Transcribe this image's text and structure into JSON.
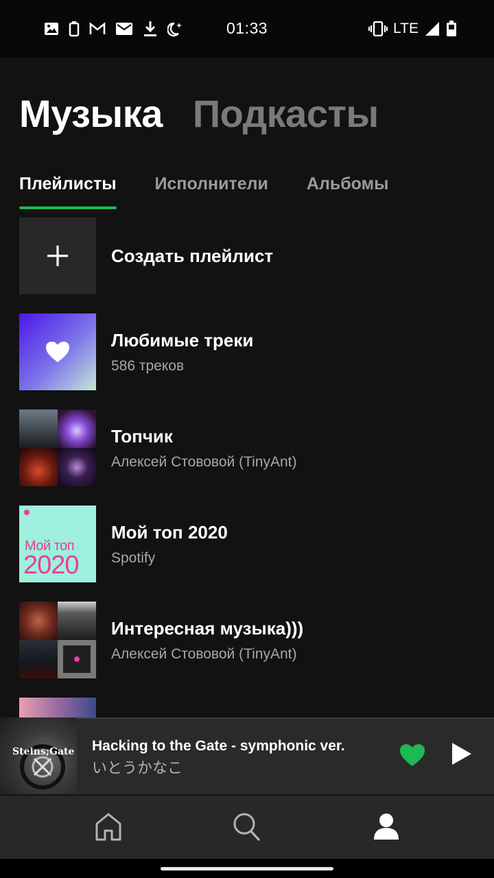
{
  "status_bar": {
    "time": "01:33",
    "network": "LTE",
    "left_icons": [
      "image-icon",
      "battery-saver-icon",
      "gmail-icon",
      "mail-icon",
      "download-icon",
      "night-mode-icon"
    ],
    "right_icons": [
      "vibrate-icon",
      "signal-icon",
      "battery-icon"
    ]
  },
  "header": {
    "tabs": [
      {
        "label": "Музыка",
        "active": true
      },
      {
        "label": "Подкасты",
        "active": false
      }
    ]
  },
  "sub_tabs": [
    {
      "label": "Плейлисты",
      "active": true
    },
    {
      "label": "Исполнители",
      "active": false
    },
    {
      "label": "Альбомы",
      "active": false
    }
  ],
  "playlists": [
    {
      "title": "Создать плейлист",
      "subtitle": ""
    },
    {
      "title": "Любимые треки",
      "subtitle": "586 треков"
    },
    {
      "title": "Топчик",
      "subtitle": "Алексей Стововой (TinyAnt)"
    },
    {
      "title": "Мой топ 2020",
      "subtitle": "Spotify",
      "cover_line1": "Мой топ",
      "cover_line2": "2020"
    },
    {
      "title": "Интересная музыка)))",
      "subtitle": "Алексей Стововой (TinyAnt)"
    }
  ],
  "mini_player": {
    "title": "Hacking to the Gate - symphonic ver.",
    "artist": "いとうかなこ",
    "cover_text": "Steins;Gate",
    "liked": true,
    "progress": 0.01
  },
  "bottom_nav": {
    "items": [
      {
        "icon": "home-icon",
        "active": false
      },
      {
        "icon": "search-icon",
        "active": false
      },
      {
        "icon": "profile-icon",
        "active": true
      }
    ]
  },
  "colors": {
    "background": "#121212",
    "accent": "#1db954",
    "player_bg": "#2a2a2a",
    "nav_bg": "#282828"
  }
}
